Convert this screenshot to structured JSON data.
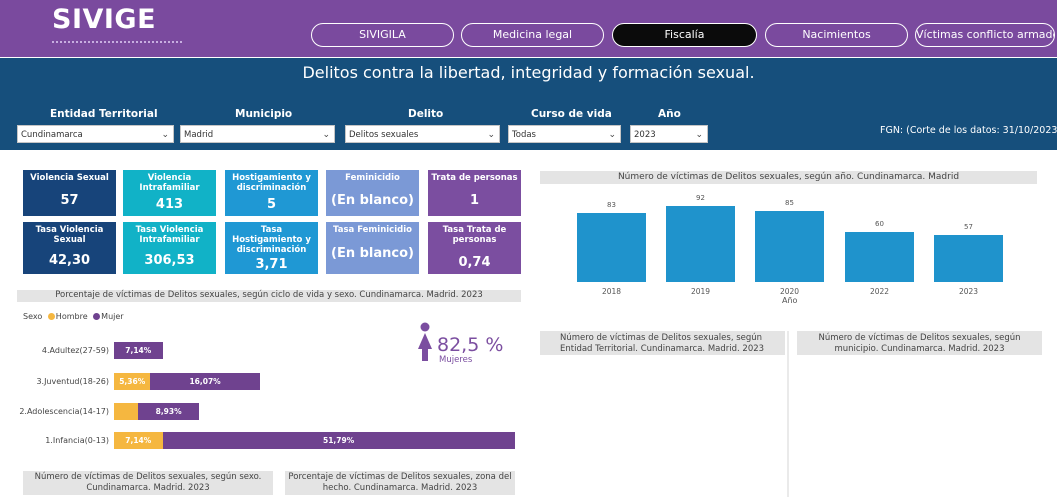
{
  "app": {
    "logo": "SIVIGE"
  },
  "nav": {
    "tabs": [
      {
        "label": "SIVIGILA",
        "active": false
      },
      {
        "label": "Medicina legal",
        "active": false
      },
      {
        "label": "Fiscalía",
        "active": true
      },
      {
        "label": "Nacimientos",
        "active": false
      },
      {
        "label": "Víctimas conflicto armado",
        "active": false
      }
    ]
  },
  "report": {
    "title": "Delitos contra la libertad, integridad y formación sexual."
  },
  "filters": {
    "entidad": {
      "label": "Entidad Territorial",
      "value": "Cundinamarca"
    },
    "municipio": {
      "label": "Municipio",
      "value": "Madrid"
    },
    "delito": {
      "label": "Delito",
      "value": "Delitos sexuales"
    },
    "curso": {
      "label": "Curso de vida",
      "value": "Todas"
    },
    "anio": {
      "label": "Año",
      "value": "2023"
    },
    "note": "FGN: (Corte de los datos: 31/10/2023)"
  },
  "kpis": {
    "row1": [
      {
        "label": "Violencia Sexual",
        "value": "57",
        "color": "#17447a"
      },
      {
        "label": "Violencia Intrafamiliar",
        "value": "413",
        "color": "#11b2c7"
      },
      {
        "label": "Hostigamiento y discriminación",
        "value": "5",
        "color": "#1f98d4"
      },
      {
        "label": "Feminicidio",
        "value": "(En blanco)",
        "color": "#7b99d6"
      },
      {
        "label": "Trata de personas",
        "value": "1",
        "color": "#7b4ea0"
      }
    ],
    "row2": [
      {
        "label": "Tasa Violencia Sexual",
        "value": "42,30",
        "color": "#17447a"
      },
      {
        "label": "Tasa Violencia Intrafamiliar",
        "value": "306,53",
        "color": "#11b2c7"
      },
      {
        "label": "Tasa Hostigamiento y discriminación",
        "value": "3,71",
        "color": "#1f98d4"
      },
      {
        "label": "Tasa Feminicidio",
        "value": "(En blanco)",
        "color": "#7b99d6"
      },
      {
        "label": "Tasa Trata de personas",
        "value": "0,74",
        "color": "#7b4ea0"
      }
    ]
  },
  "stacked": {
    "title": "Porcentaje de víctimas de Delitos sexuales, según ciclo de vida y sexo. Cundinamarca. Madrid. 2023",
    "legend": {
      "title": "Sexo",
      "hombre": "Hombre",
      "mujer": "Mujer"
    },
    "women_pct": "82,5 %",
    "women_label": "Mujeres"
  },
  "bottom": {
    "sexo_title": "Número de víctimas de Delitos sexuales, según sexo. Cundinamarca. Madrid. 2023",
    "zona_title": "Porcentaje de víctimas de Delitos sexuales, zona del hecho. Cundinamarca. Madrid. 2023",
    "entidad_title": "Número de víctimas de Delitos sexuales, según Entidad Territorial. Cundinamarca. Madrid. 2023",
    "municipio_title": "Número de víctimas de Delitos sexuales, según municipio. Cundinamarca. Madrid. 2023"
  },
  "chart_data": [
    {
      "type": "bar",
      "orientation": "horizontal",
      "stacked": true,
      "title": "Porcentaje de víctimas de Delitos sexuales, según ciclo de vida y sexo. Cundinamarca. Madrid. 2023",
      "categories": [
        "4.Adultez(27-59)",
        "3.Juventud(18-26)",
        "2.Adolescencia(14-17)",
        "1.Infancia(0-13)"
      ],
      "series": [
        {
          "name": "Hombre",
          "color": "#f5b740",
          "values": [
            0,
            5.36,
            3.57,
            7.14
          ],
          "labels": [
            "",
            "5,36%",
            "",
            "7,14%"
          ]
        },
        {
          "name": "Mujer",
          "color": "#6f428f",
          "values": [
            7.14,
            16.07,
            8.93,
            51.79
          ],
          "labels": [
            "7,14%",
            "16,07%",
            "8,93%",
            "51,79%"
          ]
        }
      ],
      "legend_position": "top-left"
    },
    {
      "type": "bar",
      "title": "Número de víctimas de Delitos sexuales, según año. Cundinamarca. Madrid",
      "xlabel": "Año",
      "categories": [
        "2018",
        "2019",
        "2020",
        "2022",
        "2023"
      ],
      "values": [
        83,
        92,
        85,
        60,
        57
      ],
      "color": "#1f93cc",
      "ylim": [
        0,
        100
      ]
    }
  ]
}
